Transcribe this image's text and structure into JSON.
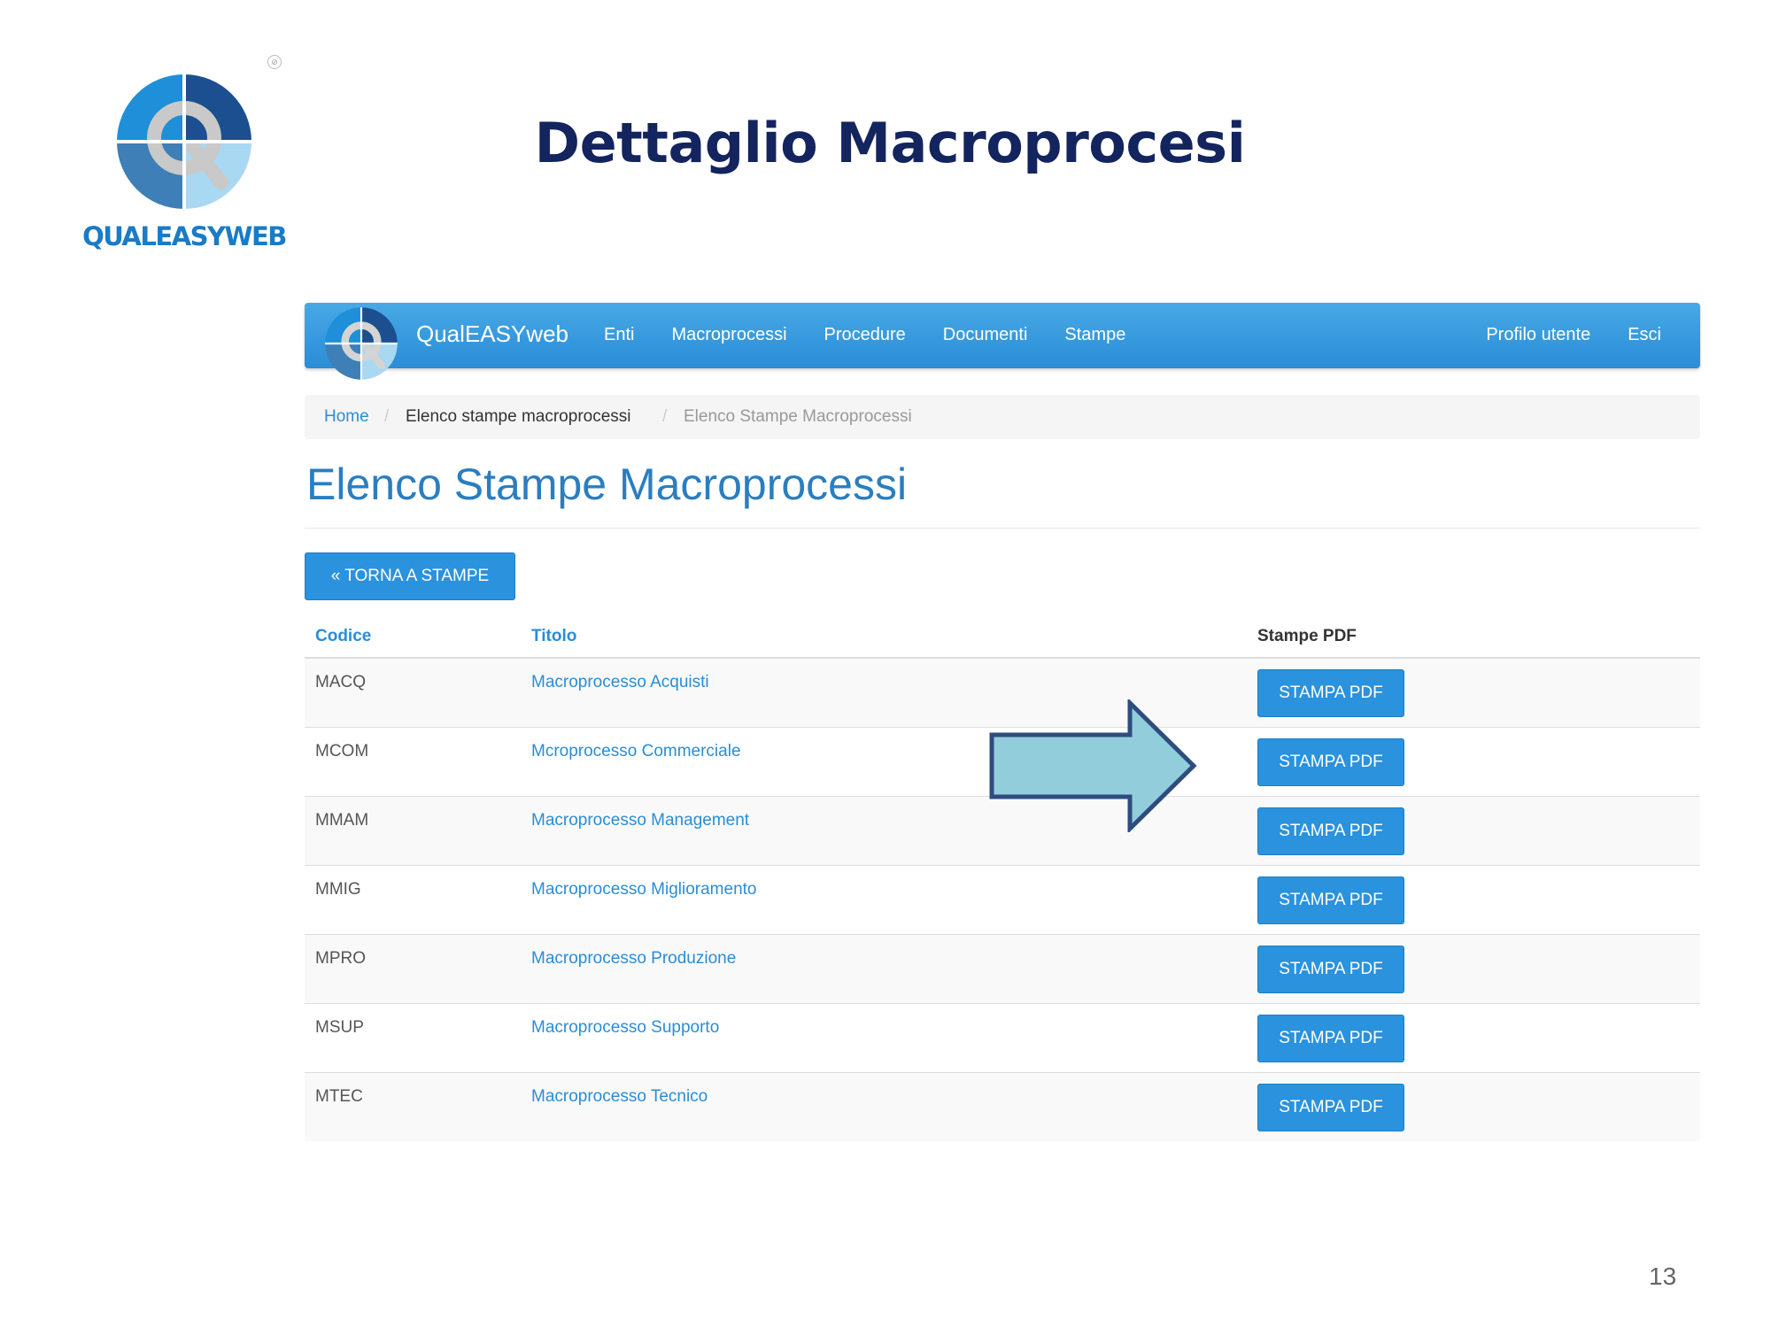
{
  "slide": {
    "title": "Dettaglio Macroprocesi",
    "logo_text": "QUALEASYWEB",
    "page_number": "13"
  },
  "navbar": {
    "brand": "QualEASYweb",
    "links": [
      "Enti",
      "Macroprocessi",
      "Procedure",
      "Documenti",
      "Stampe"
    ],
    "right_links": [
      "Profilo utente",
      "Esci"
    ]
  },
  "breadcrumb": {
    "home": "Home",
    "parent": "Elenco stampe macroprocessi",
    "current": "Elenco Stampe Macroprocessi",
    "separator": "/"
  },
  "page": {
    "title": "Elenco Stampe Macroprocessi",
    "back_button": "« TORNA A STAMPE"
  },
  "table": {
    "headers": {
      "code": "Codice",
      "title": "Titolo",
      "pdf": "Stampe PDF"
    },
    "pdf_button_label": "STAMPA PDF",
    "rows": [
      {
        "code": "MACQ",
        "title": "Macroprocesso Acquisti"
      },
      {
        "code": "MCOM",
        "title": "Mcroprocesso Commerciale"
      },
      {
        "code": "MMAM",
        "title": "Macroprocesso Management"
      },
      {
        "code": "MMIG",
        "title": "Macroprocesso Miglioramento"
      },
      {
        "code": "MPRO",
        "title": "Macroprocesso Produzione"
      },
      {
        "code": "MSUP",
        "title": "Macroprocesso Supporto"
      },
      {
        "code": "MTEC",
        "title": "Macroprocesso Tecnico"
      }
    ]
  },
  "colors": {
    "accent": "#2b92dd",
    "title_dark": "#13245e",
    "arrow_fill": "#92cddc"
  }
}
